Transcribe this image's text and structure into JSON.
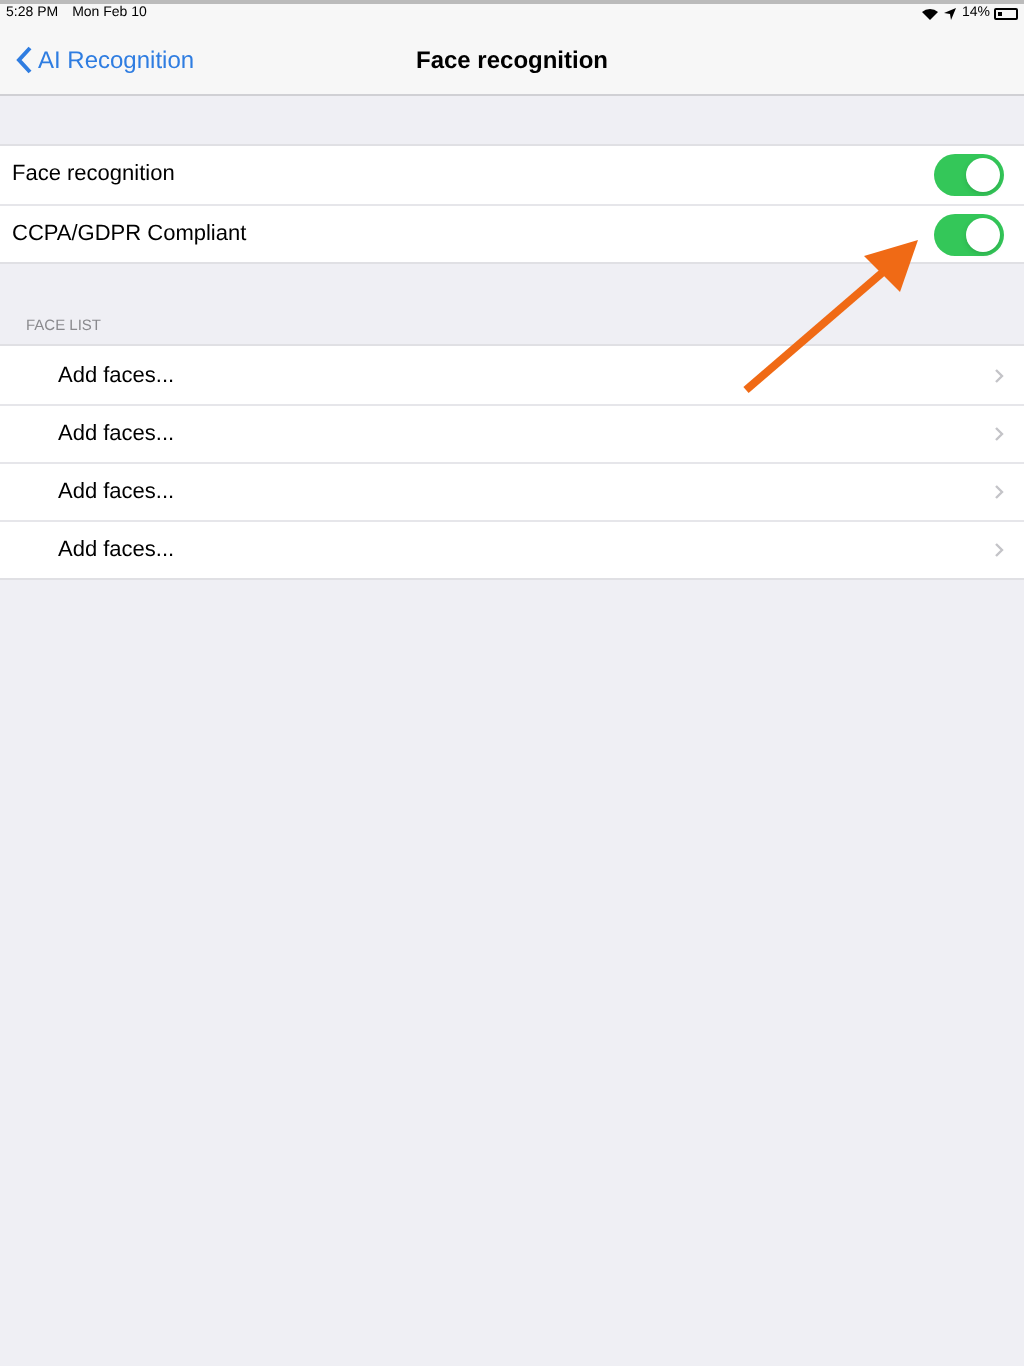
{
  "status_bar": {
    "time": "5:28 PM",
    "date": "Mon Feb 10",
    "battery": "14%"
  },
  "nav": {
    "back": "AI Recognition",
    "title": "Face recognition"
  },
  "settings": [
    {
      "label": "Face recognition",
      "on": true
    },
    {
      "label": "CCPA/GDPR Compliant",
      "on": true
    }
  ],
  "face_list": {
    "header": "FACE LIST",
    "items": [
      {
        "label": "Add faces..."
      },
      {
        "label": "Add faces..."
      },
      {
        "label": "Add faces..."
      },
      {
        "label": "Add faces..."
      }
    ]
  }
}
